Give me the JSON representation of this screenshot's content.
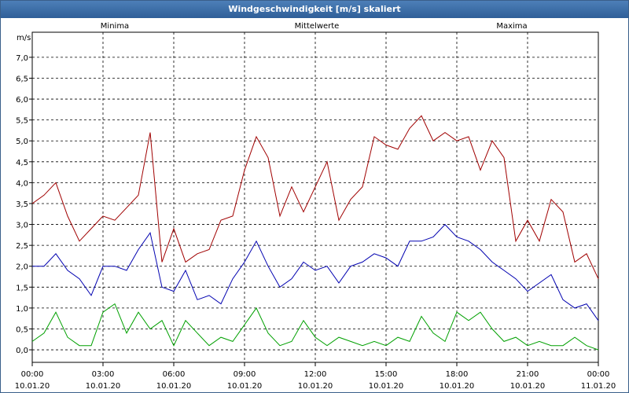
{
  "window": {
    "title": "Windgeschwindigkeit [m/s] skaliert"
  },
  "chart_data": {
    "type": "line",
    "title": "Windgeschwindigkeit [m/s] skaliert",
    "ylabel": "m/s",
    "ylim": [
      -0.3,
      7.6
    ],
    "yticks": [
      0.0,
      0.5,
      1.0,
      1.5,
      2.0,
      2.5,
      3.0,
      3.5,
      4.0,
      4.5,
      5.0,
      5.5,
      6.0,
      6.5,
      7.0
    ],
    "ytick_labels": [
      "0,0",
      "0,5",
      "1,0",
      "1,5",
      "2,0",
      "2,5",
      "3,0",
      "3,5",
      "4,0",
      "4,5",
      "5,0",
      "5,5",
      "6,0",
      "6,5",
      "7,0"
    ],
    "xlim_hours": [
      0,
      24
    ],
    "xticks": [
      {
        "time": "00:00",
        "date": "10.01.20"
      },
      {
        "time": "03:00",
        "date": "10.01.20"
      },
      {
        "time": "06:00",
        "date": "10.01.20"
      },
      {
        "time": "09:00",
        "date": "10.01.20"
      },
      {
        "time": "12:00",
        "date": "10.01.20"
      },
      {
        "time": "15:00",
        "date": "10.01.20"
      },
      {
        "time": "18:00",
        "date": "10.01.20"
      },
      {
        "time": "21:00",
        "date": "10.01.20"
      },
      {
        "time": "00:00",
        "date": "11.01.20"
      }
    ],
    "grid": true,
    "series": [
      {
        "name": "Minima",
        "color": "#00a000",
        "x": [
          0,
          0.5,
          1,
          1.5,
          2,
          2.5,
          3,
          3.5,
          4,
          4.5,
          5,
          5.5,
          6,
          6.5,
          7,
          7.5,
          8,
          8.5,
          9,
          9.5,
          10,
          10.5,
          11,
          11.5,
          12,
          12.5,
          13,
          13.5,
          14,
          14.5,
          15,
          15.5,
          16,
          16.5,
          17,
          17.5,
          18,
          18.5,
          19,
          19.5,
          20,
          20.5,
          21,
          21.5,
          22,
          22.5,
          23,
          23.5,
          24
        ],
        "y": [
          0.2,
          0.4,
          0.9,
          0.3,
          0.1,
          0.1,
          0.9,
          1.1,
          0.4,
          0.9,
          0.5,
          0.7,
          0.1,
          0.7,
          0.4,
          0.1,
          0.3,
          0.2,
          0.6,
          1.0,
          0.4,
          0.1,
          0.2,
          0.7,
          0.3,
          0.1,
          0.3,
          0.2,
          0.1,
          0.2,
          0.1,
          0.3,
          0.2,
          0.8,
          0.4,
          0.2,
          0.9,
          0.7,
          0.9,
          0.5,
          0.2,
          0.3,
          0.1,
          0.2,
          0.1,
          0.1,
          0.3,
          0.1,
          0.0
        ]
      },
      {
        "name": "Mittelwerte",
        "color": "#0000b0",
        "x": [
          0,
          0.5,
          1,
          1.5,
          2,
          2.5,
          3,
          3.5,
          4,
          4.5,
          5,
          5.5,
          6,
          6.5,
          7,
          7.5,
          8,
          8.5,
          9,
          9.5,
          10,
          10.5,
          11,
          11.5,
          12,
          12.5,
          13,
          13.5,
          14,
          14.5,
          15,
          15.5,
          16,
          16.5,
          17,
          17.5,
          18,
          18.5,
          19,
          19.5,
          20,
          20.5,
          21,
          21.5,
          22,
          22.5,
          23,
          23.5,
          24
        ],
        "y": [
          2.0,
          2.0,
          2.3,
          1.9,
          1.7,
          1.3,
          2.0,
          2.0,
          1.9,
          2.4,
          2.8,
          1.5,
          1.4,
          1.9,
          1.2,
          1.3,
          1.1,
          1.7,
          2.1,
          2.6,
          2.0,
          1.5,
          1.7,
          2.1,
          1.9,
          2.0,
          1.6,
          2.0,
          2.1,
          2.3,
          2.2,
          2.0,
          2.6,
          2.6,
          2.7,
          3.0,
          2.7,
          2.6,
          2.4,
          2.1,
          1.9,
          1.7,
          1.4,
          1.6,
          1.8,
          1.2,
          1.0,
          1.1,
          0.7
        ]
      },
      {
        "name": "Maxima",
        "color": "#a00000",
        "x": [
          0,
          0.5,
          1,
          1.5,
          2,
          2.5,
          3,
          3.5,
          4,
          4.5,
          5,
          5.5,
          6,
          6.5,
          7,
          7.5,
          8,
          8.5,
          9,
          9.5,
          10,
          10.5,
          11,
          11.5,
          12,
          12.5,
          13,
          13.5,
          14,
          14.5,
          15,
          15.5,
          16,
          16.5,
          17,
          17.5,
          18,
          18.5,
          19,
          19.5,
          20,
          20.5,
          21,
          21.5,
          22,
          22.5,
          23,
          23.5,
          24
        ],
        "y": [
          3.5,
          3.7,
          4.0,
          3.2,
          2.6,
          2.9,
          3.2,
          3.1,
          3.4,
          3.7,
          5.2,
          2.1,
          2.9,
          2.1,
          2.3,
          2.4,
          3.1,
          3.2,
          4.3,
          5.1,
          4.6,
          3.2,
          3.9,
          3.3,
          3.9,
          4.5,
          3.1,
          3.6,
          3.9,
          5.1,
          4.9,
          4.8,
          5.3,
          5.6,
          5.0,
          5.2,
          5.0,
          5.1,
          4.3,
          5.0,
          4.6,
          2.6,
          3.1,
          2.6,
          3.6,
          3.3,
          2.1,
          2.3,
          1.7
        ]
      }
    ]
  }
}
